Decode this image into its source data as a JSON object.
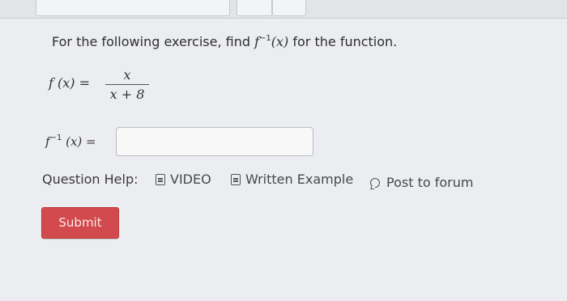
{
  "question": {
    "prompt_before": "For the following exercise, find ",
    "prompt_func": "f",
    "prompt_sup": "−1",
    "prompt_arg": "(x)",
    "prompt_after": " for the function.",
    "fx_label": "f (x) =",
    "fraction_numerator": "x",
    "fraction_denominator": "x + 8",
    "answer_label_func": "f",
    "answer_label_sup": "−1",
    "answer_label_rest": "(x) =",
    "answer_value": ""
  },
  "help": {
    "label": "Question Help:",
    "video": "VIDEO",
    "written_example": "Written Example",
    "post_to_forum": "Post to forum"
  },
  "actions": {
    "submit_label": "Submit"
  },
  "colors": {
    "submit": "#d24a4d",
    "background": "#ecedf0"
  }
}
